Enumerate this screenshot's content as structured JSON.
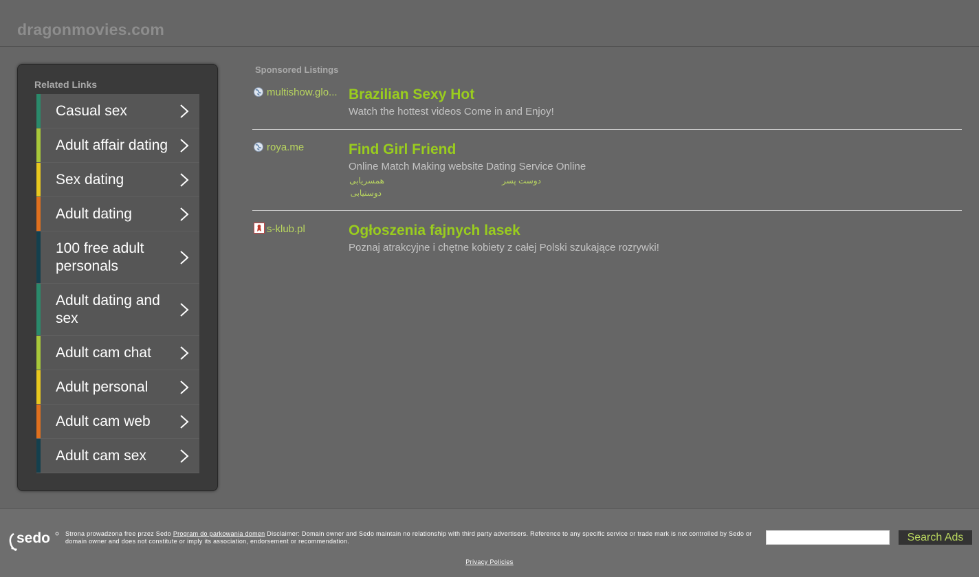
{
  "header": {
    "domain": "dragonmovies.com"
  },
  "related": {
    "title": "Related Links",
    "items": [
      {
        "label": "Casual sex",
        "color": "#2a8a6b"
      },
      {
        "label": "Adult affair dating",
        "color": "#a8c83a"
      },
      {
        "label": "Sex dating",
        "color": "#e8c81e"
      },
      {
        "label": "Adult dating",
        "color": "#e0701e"
      },
      {
        "label": "100 free adult personals",
        "color": "#14404e"
      },
      {
        "label": "Adult dating and sex",
        "color": "#2a8a6b"
      },
      {
        "label": "Adult cam chat",
        "color": "#a8c83a"
      },
      {
        "label": "Adult personal",
        "color": "#e8c81e"
      },
      {
        "label": "Adult cam web",
        "color": "#e0701e"
      },
      {
        "label": "Adult cam sex",
        "color": "#14404e"
      }
    ]
  },
  "sponsored": {
    "title": "Sponsored Listings",
    "ads": [
      {
        "site": "multishow.glo...",
        "title": "Brazilian Sexy Hot",
        "desc": "Watch the hottest videos Come in and Enjoy!",
        "favicon": "globe-icon"
      },
      {
        "site": "roya.me",
        "title": "Find Girl Friend",
        "desc": "Online Match Making website Dating Service Online",
        "favicon": "globe-icon",
        "sublinks": [
          "همسریابی",
          "دوست پسر",
          "دوستیابی"
        ]
      },
      {
        "site": "s-klub.pl",
        "title": "Ogłoszenia fajnych lasek",
        "desc": "Poznaj atrakcyjne i chętne kobiety z całej Polski szukające rozrywki!",
        "favicon": "site-favicon-icon"
      }
    ]
  },
  "footer": {
    "disclaimer_prefix": "Strona prowadzona free przez Sedo",
    "program_link": "Program do parkowania domen",
    "disclaimer_suffix": "Disclaimer: Domain owner and Sedo maintain no relationship with third party advertisers. Reference to any specific service or trade mark is not controlled by Sedo or domain owner and does not constitute or imply its association, endorsement or recommendation.",
    "search_placeholder": "",
    "search_button": "Search Ads",
    "privacy": "Privacy Policies",
    "logo_text": "sedo"
  }
}
